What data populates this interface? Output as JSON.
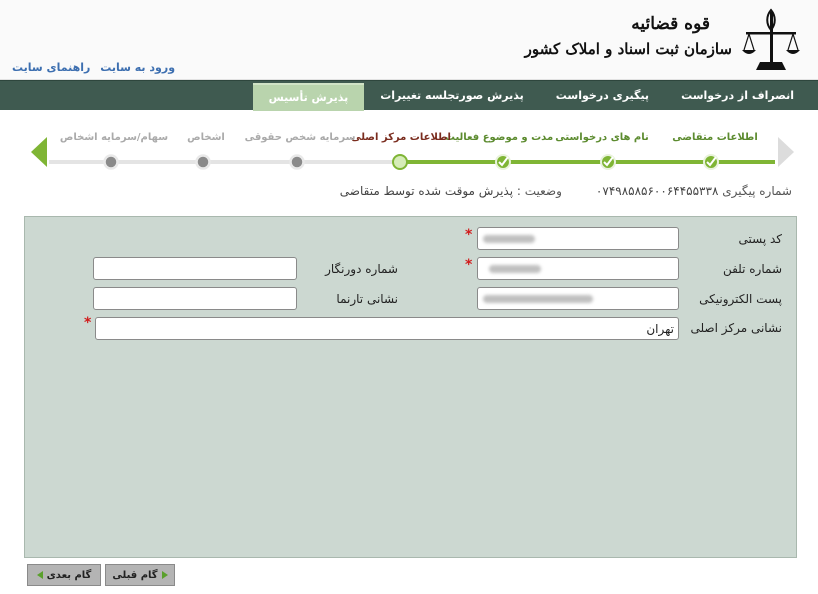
{
  "header": {
    "org_line1": "قوه قضائیه",
    "org_line2": "سازمان ثبت اسناد و املاک کشور",
    "links": [
      "ورود به سایت",
      "راهنمای سایت"
    ]
  },
  "menu": {
    "items": [
      {
        "label": "پذیرش تأسیس",
        "active": true
      },
      {
        "label": "پذیرش صورتجلسه تغییرات",
        "active": false
      },
      {
        "label": "پیگیری درخواست",
        "active": false
      },
      {
        "label": "انصراف از درخواست",
        "active": false
      }
    ]
  },
  "steps": [
    {
      "label": "اطلاعات متقاضی",
      "state": "done"
    },
    {
      "label": "نام های درخواستی",
      "state": "done"
    },
    {
      "label": "مدت و موضوع فعالیت",
      "state": "done"
    },
    {
      "label": "اطلاعات مرکز اصلی",
      "state": "current"
    },
    {
      "label": "سرمایه شخص حقوقی",
      "state": "todo"
    },
    {
      "label": "اشخاص",
      "state": "todo"
    },
    {
      "label": "سهام/سرمایه اشخاص",
      "state": "todo"
    }
  ],
  "status": {
    "tracking_label": "شماره پیگیری",
    "tracking_value": "۰۷۴۹۸۵۸۵۶۰۰۶۴۴۵۵۳۳۸",
    "state_label": "وضعیت :",
    "state_value": "پذیرش موقت شده توسط متقاضی"
  },
  "form": {
    "postal_code_label": "کد پستی",
    "phone_label": "شماره تلفن",
    "email_label": "پست الکترونیکی",
    "address_label": "نشانی مرکز اصلی",
    "address_value": "تهران",
    "fax_label": "شماره دورنگار",
    "website_label": "نشانی تارنما"
  },
  "buttons": {
    "prev": "گام قبلی",
    "next": "گام بعدی"
  },
  "colors": {
    "menu_bg": "#3f5a50",
    "menu_active": "#b9d4ad",
    "done_green": "#7fb535",
    "panel_bg": "#ccd8d1",
    "required": "#d11a1a"
  }
}
